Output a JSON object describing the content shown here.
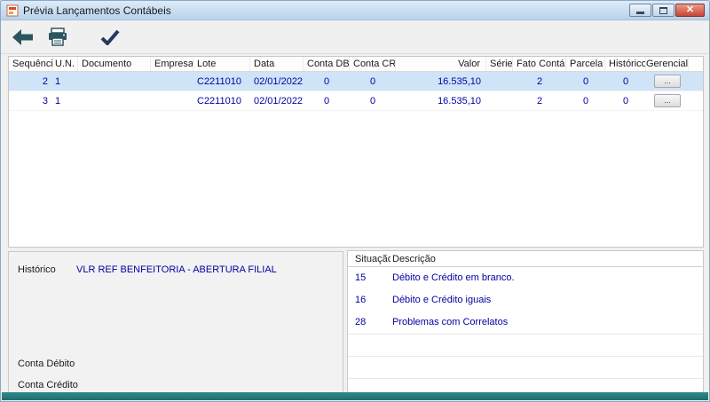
{
  "window": {
    "title": "Prévia Lançamentos Contábeis",
    "close_glyph": "✕"
  },
  "toolbar": {
    "icons": [
      "back-arrow-icon",
      "printer-icon",
      "confirm-check-icon"
    ]
  },
  "grid": {
    "columns": [
      "Sequência",
      "U.N.",
      "Documento",
      "Empresa",
      "Lote",
      "Data",
      "Conta DB",
      "Conta CR",
      "Valor",
      "Série",
      "Fato Contábil",
      "Parcela",
      "Histórico",
      "Gerencial"
    ],
    "rows": [
      {
        "sequencia": "2",
        "un": "1",
        "documento": "",
        "empresa": "",
        "lote": "C2211010",
        "data": "02/01/2022",
        "conta_db": "0",
        "conta_cr": "0",
        "valor": "16.535,10",
        "serie": "",
        "fato_contabil": "2",
        "parcela": "0",
        "historico": "0",
        "gerencial": "..."
      },
      {
        "sequencia": "3",
        "un": "1",
        "documento": "",
        "empresa": "",
        "lote": "C2211010",
        "data": "02/01/2022",
        "conta_db": "0",
        "conta_cr": "0",
        "valor": "16.535,10",
        "serie": "",
        "fato_contabil": "2",
        "parcela": "0",
        "historico": "0",
        "gerencial": "..."
      }
    ]
  },
  "detail": {
    "historico_label": "Histórico",
    "historico_value": "VLR REF BENFEITORIA - ABERTURA FILIAL",
    "conta_debito_label": "Conta Débito",
    "conta_credito_label": "Conta Crédito"
  },
  "situacoes": {
    "columns": [
      "Situação",
      "Descrição"
    ],
    "rows": [
      {
        "situacao": "15",
        "descricao": "Débito e Crédito em branco."
      },
      {
        "situacao": "16",
        "descricao": "Débito e Crédito iguais"
      },
      {
        "situacao": "28",
        "descricao": "Problemas com Correlatos"
      }
    ]
  },
  "colors": {
    "data_text": "#0000a0",
    "selected_row": "#cfe4f7",
    "statusbar_teal": "#2a7c7c",
    "close_button_red": "#c94433"
  }
}
